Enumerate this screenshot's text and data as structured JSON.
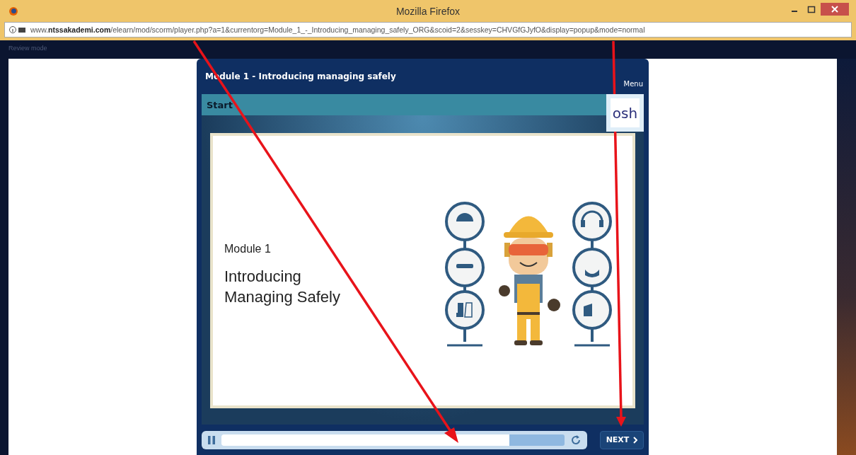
{
  "window": {
    "title": "Mozilla Firefox"
  },
  "address_bar": {
    "url": "www.**ntssakademi.com**/elearn/mod/scorm/player.php?a=1&currentorg=Module_1_-_Introducing_managing_safely_ORG&scoid=2&sesskey=CHVGfGJyfO&display=popup&mode=normal"
  },
  "mode_label": "Review mode",
  "player": {
    "title": "Module 1 - Introducing managing safely",
    "menu": "Menu",
    "section": "Start",
    "logo": "osh",
    "slide": {
      "subtitle": "Module 1",
      "heading": "Introducing Managing Safely"
    },
    "controls": {
      "playing": true,
      "level": 0.84,
      "next": "NEXT"
    }
  }
}
